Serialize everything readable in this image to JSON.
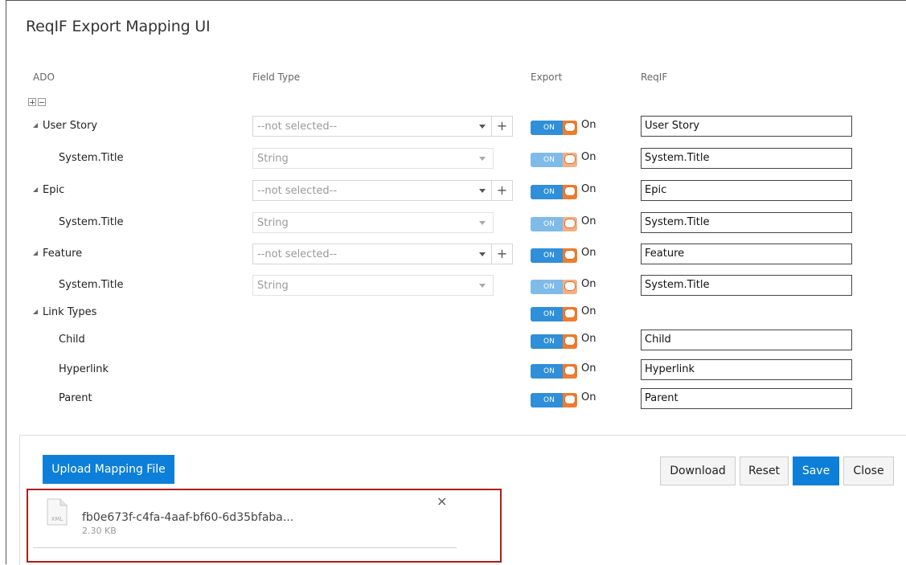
{
  "dialog": {
    "title": "ReqIF Export Mapping UI"
  },
  "columns": {
    "ado": "ADO",
    "field_type": "Field Type",
    "export": "Export",
    "reqif": "ReqIF"
  },
  "rows": [
    {
      "label": "User Story",
      "field_type": "--not selected--",
      "export": "On",
      "reqif": "User Story"
    },
    {
      "label": "System.Title",
      "field_type": "String",
      "export": "On",
      "reqif": "System.Title"
    },
    {
      "label": "Epic",
      "field_type": "--not selected--",
      "export": "On",
      "reqif": "Epic"
    },
    {
      "label": "System.Title",
      "field_type": "String",
      "export": "On",
      "reqif": "System.Title"
    },
    {
      "label": "Feature",
      "field_type": "--not selected--",
      "export": "On",
      "reqif": "Feature"
    },
    {
      "label": "System.Title",
      "field_type": "String",
      "export": "On",
      "reqif": "System.Title"
    },
    {
      "label": "Link Types",
      "export": "On"
    },
    {
      "label": "Child",
      "export": "On",
      "reqif": "Child"
    },
    {
      "label": "Hyperlink",
      "export": "On",
      "reqif": "Hyperlink"
    },
    {
      "label": "Parent",
      "export": "On",
      "reqif": "Parent"
    }
  ],
  "toggle": {
    "on_text": "ON"
  },
  "add_symbol": "+",
  "footer": {
    "upload_label": "Upload Mapping File",
    "download_label": "Download",
    "reset_label": "Reset",
    "save_label": "Save",
    "close_label": "Close"
  },
  "file": {
    "name": "fb0e673f-c4fa-4aaf-bf60-6d35bfaba...",
    "size": "2.30 KB",
    "type": "XML",
    "close_symbol": "×"
  },
  "colors": {
    "primary": "#0d7fd8",
    "toggle_on": "#2f8fd8",
    "toggle_accent": "#ef7c2e",
    "highlight_border": "#b01c1c"
  },
  "icons": [
    "expand-all-icon",
    "collapse-all-icon",
    "tree-expanded-icon",
    "dropdown-arrow-icon",
    "plus-icon",
    "xml-file-icon",
    "close-icon"
  ]
}
